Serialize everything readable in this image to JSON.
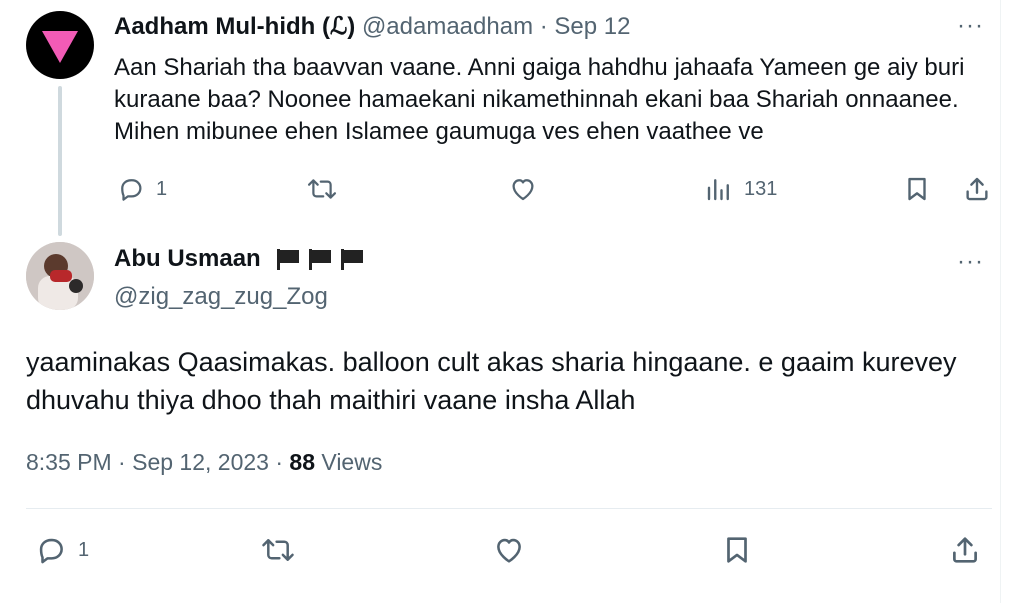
{
  "parent": {
    "display_name": "Aadham Mul-hidh (ℒ)",
    "handle": "@adamaadham",
    "date": "Sep 12",
    "text": "Aan Shariah tha baavvan vaane. Anni gaiga hahdhu jahaafa Yameen ge aiy buri kuraane baa? Noonee hamaekani nikamethinnah ekani baa Shariah onnaanee. Mihen mibunee ehen Islamee gaumuga ves ehen vaathee ve",
    "more": "···",
    "actions": {
      "replies": "1",
      "views": "131"
    }
  },
  "reply": {
    "display_name": "Abu Usmaan",
    "handle": "@zig_zag_zug_Zog",
    "more": "···",
    "text": "yaaminakas Qaasimakas. balloon cult akas sharia hingaane. e gaaim kurevey dhuvahu thiya dhoo thah maithiri vaane insha Allah",
    "time": "8:35 PM",
    "date": "Sep 12, 2023",
    "views_count": "88",
    "views_label": "Views",
    "actions": {
      "replies": "1"
    }
  },
  "icons": {
    "reply": "reply-icon",
    "retweet": "retweet-icon",
    "like": "like-icon",
    "views": "views-icon",
    "bookmark": "bookmark-icon",
    "share": "share-icon",
    "flag": "black-flag-icon"
  },
  "colors": {
    "text": "#0f1419",
    "muted": "#536471",
    "thread_line": "#cfd9de",
    "avatar_triangle": "#f25bb6"
  }
}
